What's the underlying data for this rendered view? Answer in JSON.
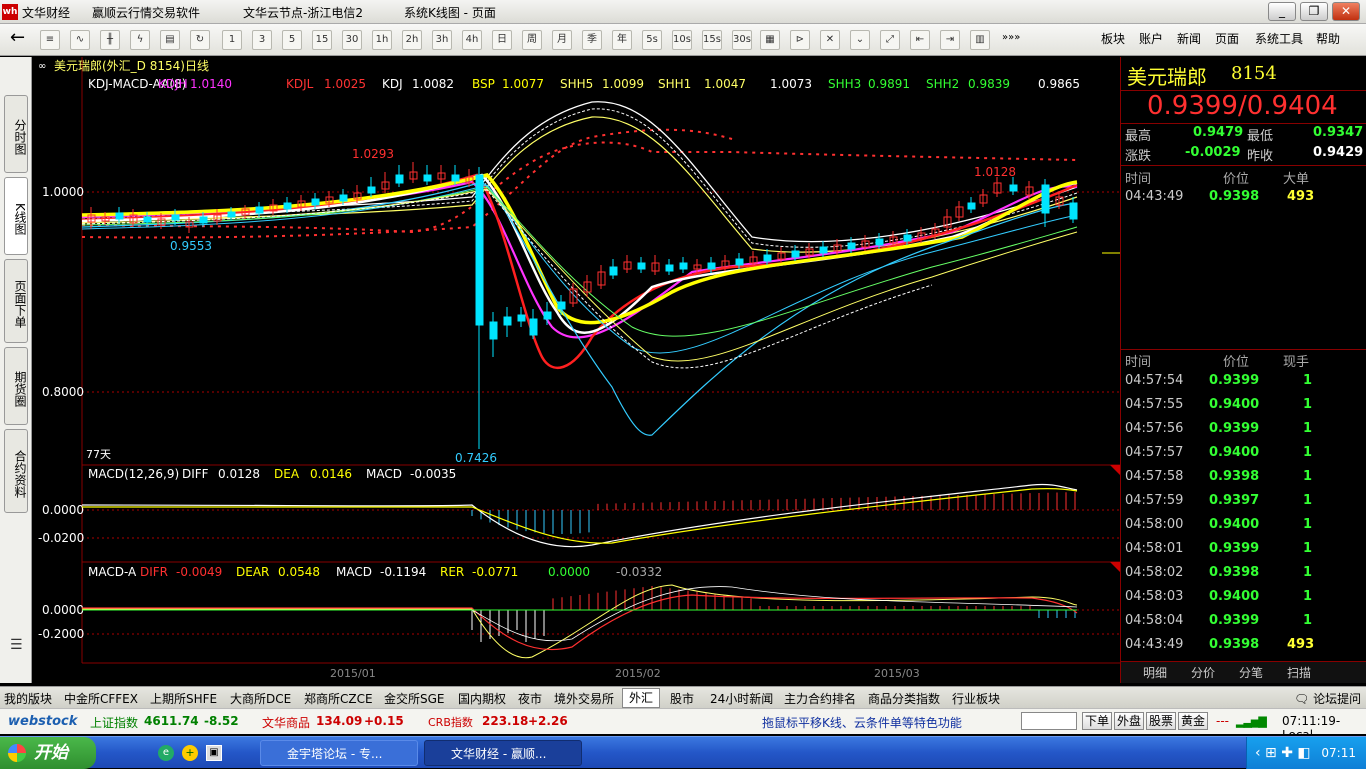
{
  "window": {
    "app": "文华财经",
    "software": "赢顺云行情交易软件",
    "node": "文华云节点-浙江电信2",
    "view": "系统K线图 - 页面",
    "logo": "wh"
  },
  "winbtns": [
    "_",
    "❐",
    "✕"
  ],
  "toolbar": {
    "back": "←",
    "buttons": [
      "1",
      "3",
      "5",
      "15",
      "30",
      "1h",
      "2h",
      "3h",
      "4h",
      "日",
      "周",
      "月",
      "季",
      "年",
      "5s",
      "10s",
      "15s",
      "30s"
    ],
    "more": "»»»",
    "menus": [
      "板块",
      "账户",
      "新闻",
      "页面",
      "系统工具",
      "帮助"
    ]
  },
  "left_tabs": [
    "分时图",
    "K线图",
    "页面下单",
    "期货圈",
    "合约资料"
  ],
  "chart": {
    "header": "美元瑞郎(外汇_D 8154)日线",
    "indicator_name": "KDJ-MACD-AA(8)",
    "ind": [
      {
        "l": "KDJH",
        "v": "1.0140",
        "c": "#ff33ff"
      },
      {
        "l": "KDJL",
        "v": "1.0025",
        "c": "#ff3333"
      },
      {
        "l": "KDJ",
        "v": "1.0082",
        "c": "#ffffff"
      },
      {
        "l": "BSP",
        "v": "1.0077",
        "c": "#ffff00"
      },
      {
        "l": "SHH5",
        "v": "1.0099",
        "c": "#ffff66"
      },
      {
        "l": "SHH1",
        "v": "1.0047",
        "c": "#ffff66"
      },
      {
        "l": "",
        "v": "1.0073",
        "c": "#ffffff"
      },
      {
        "l": "SHH3",
        "v": "0.9891",
        "c": "#33ff33"
      },
      {
        "l": "SHH2",
        "v": "0.9839",
        "c": "#33ff33"
      },
      {
        "l": "",
        "v": "0.9865",
        "c": "#ffffff"
      }
    ],
    "price_ticks": [
      "1.0000",
      "0.8000"
    ],
    "labels": {
      "high1": "1.0293",
      "low1": "0.9553",
      "low2": "0.7426",
      "high2": "1.0128",
      "days": "77天"
    },
    "macd": {
      "name": "MACD(12,26,9)",
      "diff_l": "DIFF",
      "diff": "0.0128",
      "dea_l": "DEA",
      "dea": "0.0146",
      "macd_l": "MACD",
      "macd": "-0.0035",
      "ticks": [
        "0.0000",
        "-0.0200"
      ]
    },
    "macda": {
      "name": "MACD-A",
      "difr_l": "DIFR",
      "difr": "-0.0049",
      "dear_l": "DEAR",
      "dear": "0.0548",
      "macd_l": "MACD",
      "macd": "-0.1194",
      "rer_l": "RER",
      "rer": "-0.0771",
      "v5": "0.0000",
      "v6": "-0.0332",
      "ticks": [
        "0.0000",
        "-0.2000"
      ]
    },
    "dates": [
      "2015/01",
      "2015/02",
      "2015/03"
    ]
  },
  "quote": {
    "name": "美元瑞郎",
    "code": "8154",
    "bid_ask": "0.9399/0.9404",
    "high_l": "最高",
    "high": "0.9479",
    "low_l": "最低",
    "low": "0.9347",
    "chg_l": "涨跌",
    "chg": "-0.0029",
    "prev_l": "昨收",
    "prev": "0.9429",
    "big_headers": [
      "时间",
      "价位",
      "大单"
    ],
    "big_rows": [
      [
        "04:43:49",
        "0.9398",
        "493"
      ]
    ],
    "tick_headers": [
      "时间",
      "价位",
      "现手"
    ],
    "tick_rows": [
      [
        "04:57:54",
        "0.9399",
        "1"
      ],
      [
        "04:57:55",
        "0.9400",
        "1"
      ],
      [
        "04:57:56",
        "0.9399",
        "1"
      ],
      [
        "04:57:57",
        "0.9400",
        "1"
      ],
      [
        "04:57:58",
        "0.9398",
        "1"
      ],
      [
        "04:57:59",
        "0.9397",
        "1"
      ],
      [
        "04:58:00",
        "0.9400",
        "1"
      ],
      [
        "04:58:01",
        "0.9399",
        "1"
      ],
      [
        "04:58:02",
        "0.9398",
        "1"
      ],
      [
        "04:58:03",
        "0.9400",
        "1"
      ],
      [
        "04:58:04",
        "0.9399",
        "1"
      ],
      [
        "04:43:49",
        "0.9398",
        "493"
      ]
    ],
    "panel_tabs": [
      "明细",
      "分价",
      "分笔",
      "扫描"
    ]
  },
  "bottom_tabs": [
    "我的版块",
    "中金所CFFEX",
    "上期所SHFE",
    "大商所DCE",
    "郑商所CZCE",
    "金交所SGE",
    "国内期权",
    "夜市",
    "境外交易所",
    "外汇",
    "股市",
    "24小时新闻",
    "主力合约排名",
    "商品分类指数",
    "行业板块"
  ],
  "active_tab": "外汇",
  "forum": "论坛提问",
  "status": {
    "brand": "webstock",
    "idx1_l": "上证指数",
    "idx1": "4611.74",
    "idx1_c": "-8.52",
    "idx2_l": "文华商品",
    "idx2": "134.09",
    "idx2_c": "+0.15",
    "idx3_l": "CRB指数",
    "idx3": "223.18",
    "idx3_c": "+2.26",
    "marquee": "拖鼠标平移K线、云条件单等特色功能",
    "btns": [
      "下单",
      "外盘",
      "股票",
      "黄金"
    ],
    "dash": "---",
    "time": "07:11:19-Local"
  },
  "taskbar": {
    "start": "开始",
    "tasks": [
      "金宇塔论坛 - 专...",
      "文华财经 - 赢顺..."
    ],
    "clock": "07:11"
  }
}
